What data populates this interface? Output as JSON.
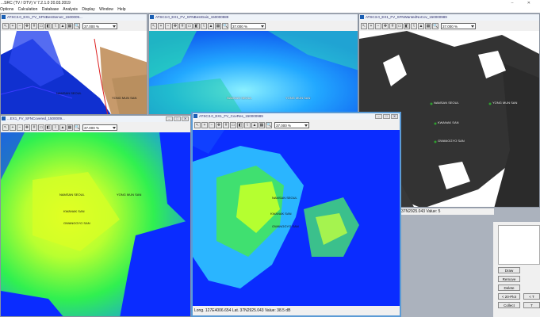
{
  "app": {
    "title": "...SRC (TV / DTV) V 7.2.1.0  20.03.2019",
    "window_controls": "–  ✕"
  },
  "menu": [
    "Options",
    "Calculation",
    "Database",
    "Analysis",
    "Display",
    "Window",
    "Help"
  ],
  "windows": [
    {
      "title": "ATSC3.0_EX1_FV_SFNBestServer_1500009..."
    },
    {
      "title": "ATSC3.0_EX1_FV_SFNBestGain_150000989"
    },
    {
      "title": "ATSC3.0_EX1_FV_SFNWantedNoCov_150000989"
    },
    {
      "title": "...EX1_FV_SFNCovered_1500009..."
    },
    {
      "title": "ATSC3.0_EX1_FV_CovRes_150000989"
    }
  ],
  "zoom_value": "37.000 %",
  "sites": [
    "NAMSAN SEOUL",
    "YONG MUN SAN",
    "KWANAK SAN",
    "GWANGGYO SAN"
  ],
  "status_main": "Long.  127E4006.654 Lat.   37N2925.043   Value:   38.5 dB",
  "status_side": "37N2925.043   Value:       5",
  "panel": {
    "draw": "Draw",
    "remove": "Remove",
    "delete": "Delete",
    "prev": "< 20-Plot",
    "next": "< T",
    "collect": "Collect",
    "t": "T"
  },
  "colors": {
    "coverage_blue": "#0a2cff",
    "coverage_green": "#3bff3b",
    "coverage_yellow": "#e6ff1a",
    "accent": "#5b9bd5"
  }
}
